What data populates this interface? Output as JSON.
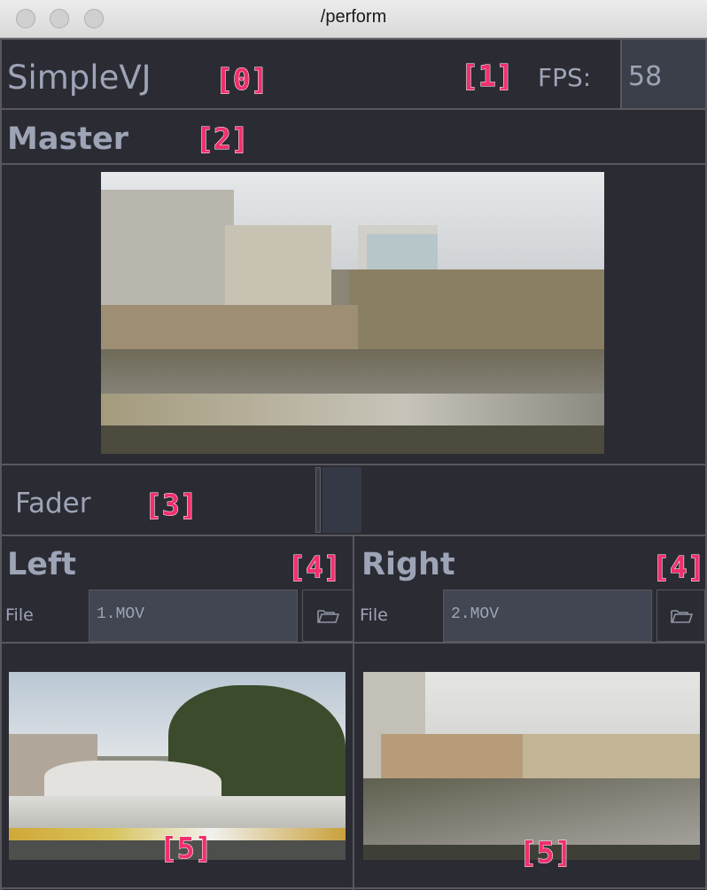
{
  "window": {
    "title": "/perform"
  },
  "header": {
    "app_name": "SimpleVJ",
    "fps_label": "FPS:",
    "fps_value": "58"
  },
  "master": {
    "label": "Master"
  },
  "fader": {
    "label": "Fader",
    "value": 0
  },
  "left": {
    "label": "Left",
    "file_label": "File",
    "file_value": "1.MOV"
  },
  "right": {
    "label": "Right",
    "file_label": "File",
    "file_value": "2.MOV"
  },
  "annotations": {
    "a0": "[0]",
    "a1": "[1]",
    "a2": "[2]",
    "a3": "[3]",
    "a4_left": "[4]",
    "a4_right": "[4]",
    "a5_left": "[5]",
    "a5_right": "[5]"
  },
  "icons": {
    "folder": "folder-icon"
  },
  "colors": {
    "background": "#2b2b33",
    "text": "#9da4b6",
    "annotation": "#f0306e"
  }
}
